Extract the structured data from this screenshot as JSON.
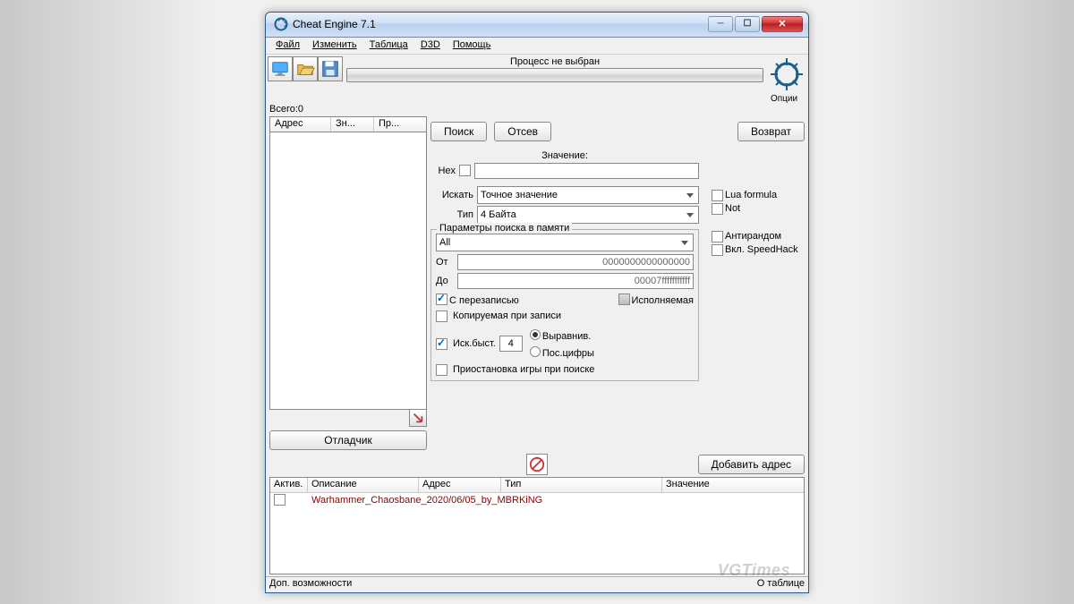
{
  "window": {
    "title": "Cheat Engine 7.1"
  },
  "menu": {
    "file": "Файл",
    "edit": "Изменить",
    "table": "Таблица",
    "d3d": "D3D",
    "help": "Помощь"
  },
  "toolbar": {
    "process_label": "Процесс не выбран",
    "options": "Опции"
  },
  "total": {
    "label": "Всего:",
    "value": "0"
  },
  "left_list": {
    "col_addr": "Адрес",
    "col_zn": "Зн...",
    "col_pr": "Пр..."
  },
  "buttons": {
    "search": "Поиск",
    "filter": "Отсев",
    "revert": "Возврат",
    "debugger": "Отладчик",
    "add_addr": "Добавить адрес"
  },
  "form": {
    "value_label": "Значение:",
    "hex": "Hex",
    "search_label": "Искать",
    "search_combo": "Точное значение",
    "type_label": "Тип",
    "type_combo": "4 Байта",
    "lua": "Lua formula",
    "not": "Not",
    "group_title": "Параметры поиска в памяти",
    "region": "All",
    "from_label": "От",
    "from_value": "0000000000000000",
    "to_label": "До",
    "to_value": "00007fffffffffff",
    "overwrite": "С перезаписью",
    "executable": "Исполняемая",
    "copyonwrite": "Копируемая при записи",
    "fastscan": "Иск.быст.",
    "fastscan_value": "4",
    "align": "Выравнив.",
    "lastdigits": "Пос.цифры",
    "pause": "Приостановка игры при поиске",
    "antirandom": "Антирандом",
    "speedhack": "Вкл. SpeedHack"
  },
  "table": {
    "th_active": "Актив.",
    "th_desc": "Описание",
    "th_addr": "Адрес",
    "th_type": "Тип",
    "th_value": "Значение",
    "rows": [
      {
        "active": false,
        "desc": "Warhammer_Chaosbane_2020/06/05_by_MBRKiNG"
      }
    ]
  },
  "status": {
    "left": "Доп. возможности",
    "right": "О таблице"
  },
  "watermark": "VGTimes"
}
